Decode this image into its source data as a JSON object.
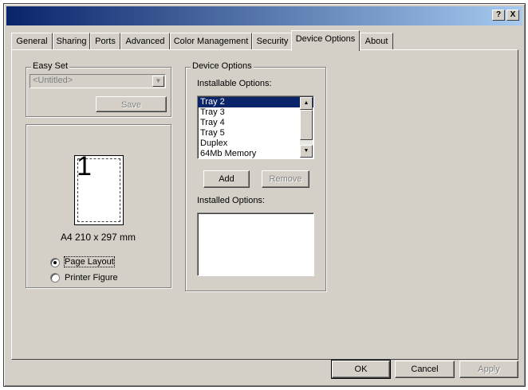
{
  "titlebar": {
    "help_label": "?",
    "close_label": "X"
  },
  "tabs": [
    {
      "label": "General"
    },
    {
      "label": "Sharing"
    },
    {
      "label": "Ports"
    },
    {
      "label": "Advanced"
    },
    {
      "label": "Color Management"
    },
    {
      "label": "Security"
    },
    {
      "label": "Device Options"
    },
    {
      "label": "About"
    }
  ],
  "easy_set": {
    "title": "Easy Set",
    "combo_value": "<Untitled>",
    "save_label": "Save"
  },
  "preview": {
    "page_number": "1",
    "paper_size": "A4 210 x 297 mm",
    "radio_page_layout": "Page Layout",
    "radio_printer_figure": "Printer Figure"
  },
  "device_options": {
    "title": "Device Options",
    "installable_label": "Installable Options:",
    "installable_items": [
      "Tray 2",
      "Tray 3",
      "Tray 4",
      "Tray 5",
      "Duplex",
      "64Mb Memory"
    ],
    "add_label": "Add",
    "remove_label": "Remove",
    "installed_label": "Installed Options:"
  },
  "footer": {
    "ok_label": "OK",
    "cancel_label": "Cancel",
    "apply_label": "Apply"
  }
}
